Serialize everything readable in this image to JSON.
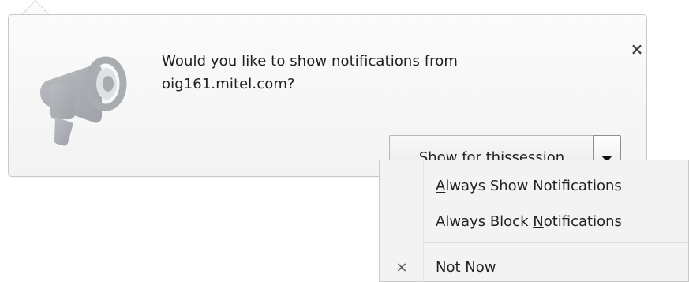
{
  "notification": {
    "message_line_1": "Would you like to show notifications from",
    "message_line_2": "oig161.mitel.com?",
    "close_symbol": "×",
    "session_button_label_prefix": "Show for thi",
    "session_button_label_accel": "s",
    "session_button_label_suffix": " session",
    "dropdown_arrow_icon": "chevron-down-icon",
    "megaphone_icon": "megaphone-icon"
  },
  "menu": {
    "items": [
      {
        "accel": "A",
        "rest": "lways Show Notifications",
        "checked": ""
      },
      {
        "prefix": "Always Block ",
        "accel": "N",
        "rest": "otifications",
        "checked": ""
      },
      {
        "label": "Not Now",
        "checked": "×"
      }
    ]
  },
  "colors": {
    "bubble_border": "#c8c8c8",
    "bubble_bg": "#f7f7f7",
    "menu_bg": "#f3f3f3",
    "megaphone": "#aeb2b7"
  }
}
